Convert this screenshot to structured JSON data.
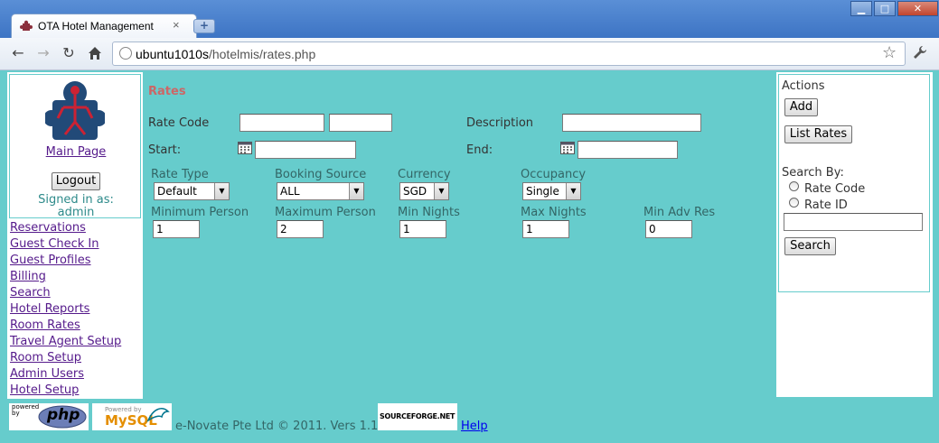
{
  "browser": {
    "tab_title": "OTA Hotel Management",
    "tab_close": "×",
    "new_tab": "+",
    "url_host": "ubuntu1010s",
    "url_path": "/hotelmis/rates.php",
    "window_buttons": {
      "minimize": "▁",
      "maximize": "□",
      "close": "✕"
    }
  },
  "sidebar": {
    "main_page": "Main Page",
    "logout": "Logout",
    "signed_in_label": "Signed in as:",
    "signed_in_user": "admin",
    "links": [
      "Reservations",
      "Guest Check In",
      "Guest Profiles",
      "Billing",
      "Search",
      "Hotel Reports",
      "Room Rates",
      "Travel Agent Setup",
      "Room Setup",
      "Admin Users",
      "Hotel Setup"
    ]
  },
  "form": {
    "title": "Rates",
    "rate_code_label": "Rate Code",
    "rate_code_1": "",
    "rate_code_2": "",
    "description_label": "Description",
    "description": "",
    "start_label": "Start:",
    "start": "",
    "end_label": "End:",
    "end": "",
    "rate_type_label": "Rate Type",
    "rate_type": "Default",
    "booking_source_label": "Booking Source",
    "booking_source": "ALL",
    "currency_label": "Currency",
    "currency": "SGD",
    "occupancy_label": "Occupancy",
    "occupancy": "Single",
    "min_person_label": "Minimum Person",
    "min_person": "1",
    "max_person_label": "Maximum Person",
    "max_person": "2",
    "min_nights_label": "Min Nights",
    "min_nights": "1",
    "max_nights_label": "Max Nights",
    "max_nights": "1",
    "min_adv_res_label": "Min Adv Res",
    "min_adv_res": "0"
  },
  "actions": {
    "title": "Actions",
    "add": "Add",
    "list_rates": "List Rates",
    "search_by": "Search By:",
    "opt_rate_code": "Rate Code",
    "opt_rate_id": "Rate ID",
    "search_value": "",
    "search": "Search"
  },
  "footer": {
    "copyright": "e-Novate Pte Ltd © 2011. Vers 1.1",
    "help": "Help",
    "php_badge": "php",
    "php_small": "powered by",
    "mysql_badge": "MySQL",
    "mysql_small": "Powered by",
    "sf_badge": "SOURCEFORGE.NET"
  },
  "colors": {
    "page_bg": "#66cccc",
    "title_red": "#cc6666",
    "link_visited": "#551a8b"
  }
}
